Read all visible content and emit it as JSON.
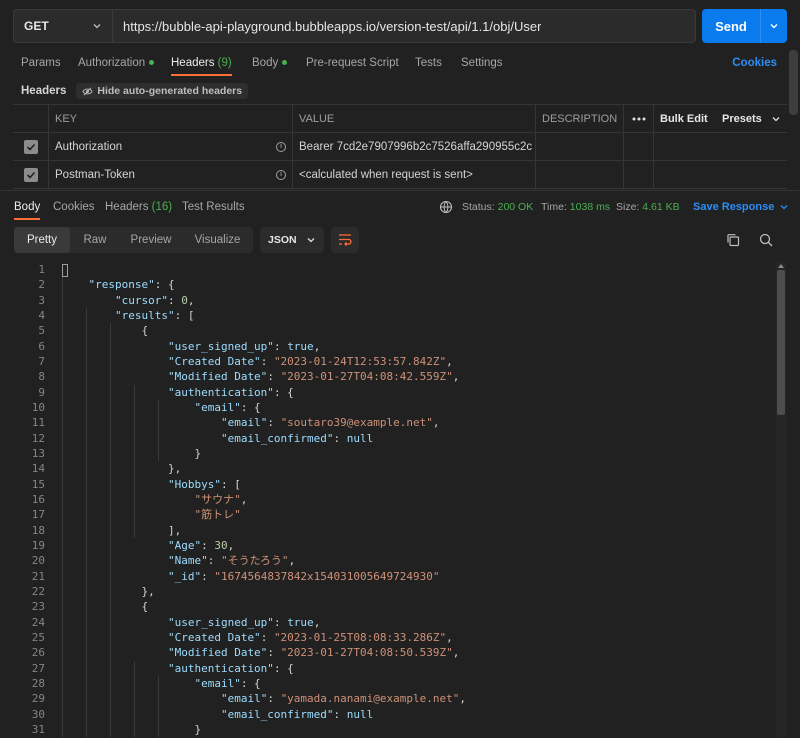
{
  "request": {
    "method": "GET",
    "url": "https://bubble-api-playground.bubbleapps.io/version-test/api/1.1/obj/User",
    "send_label": "Send"
  },
  "req_tabs": [
    {
      "label": "Params",
      "active": false
    },
    {
      "label": "Authorization",
      "dot": true,
      "active": false
    },
    {
      "label": "Headers",
      "count": "(9)",
      "active": true
    },
    {
      "label": "Body",
      "dot": true,
      "active": false
    },
    {
      "label": "Pre-request Script",
      "active": false
    },
    {
      "label": "Tests",
      "active": false
    },
    {
      "label": "Settings",
      "active": false
    }
  ],
  "cookies_label": "Cookies",
  "headers_section": {
    "title": "Headers",
    "hide_label": "Hide auto-generated headers"
  },
  "headers_table": {
    "columns": {
      "key": "KEY",
      "value": "VALUE",
      "description": "DESCRIPTION",
      "bulk_edit": "Bulk Edit",
      "presets": "Presets"
    },
    "rows": [
      {
        "key": "Authorization",
        "value": "Bearer 7cd2e7907996b2c7526affa290955c2c",
        "checked": true
      },
      {
        "key": "Postman-Token",
        "value": "<calculated when request is sent>",
        "checked": true
      }
    ]
  },
  "response": {
    "tabs": [
      {
        "label": "Body",
        "active": true
      },
      {
        "label": "Cookies",
        "active": false
      },
      {
        "label": "Headers",
        "count": "(16)",
        "active": false
      },
      {
        "label": "Test Results",
        "active": false
      }
    ],
    "status_label": "Status:",
    "status_value": "200 OK",
    "time_label": "Time:",
    "time_value": "1038 ms",
    "size_label": "Size:",
    "size_value": "4.61 KB",
    "save_label": "Save Response",
    "views": [
      "Pretty",
      "Raw",
      "Preview",
      "Visualize"
    ],
    "active_view": "Pretty",
    "format": "JSON"
  },
  "code_lines": [
    [
      [
        "p",
        "{"
      ]
    ],
    [
      [
        "p",
        "    "
      ],
      [
        "k",
        "\"response\""
      ],
      [
        "p",
        ": {"
      ]
    ],
    [
      [
        "p",
        "        "
      ],
      [
        "k",
        "\"cursor\""
      ],
      [
        "p",
        ": "
      ],
      [
        "n",
        "0"
      ],
      [
        "p",
        ","
      ]
    ],
    [
      [
        "p",
        "        "
      ],
      [
        "k",
        "\"results\""
      ],
      [
        "p",
        ": ["
      ]
    ],
    [
      [
        "p",
        "            {"
      ]
    ],
    [
      [
        "p",
        "                "
      ],
      [
        "k",
        "\"user_signed_up\""
      ],
      [
        "p",
        ": "
      ],
      [
        "b",
        "true"
      ],
      [
        "p",
        ","
      ]
    ],
    [
      [
        "p",
        "                "
      ],
      [
        "k",
        "\"Created Date\""
      ],
      [
        "p",
        ": "
      ],
      [
        "s",
        "\"2023-01-24T12:53:57.842Z\""
      ],
      [
        "p",
        ","
      ]
    ],
    [
      [
        "p",
        "                "
      ],
      [
        "k",
        "\"Modified Date\""
      ],
      [
        "p",
        ": "
      ],
      [
        "s",
        "\"2023-01-27T04:08:42.559Z\""
      ],
      [
        "p",
        ","
      ]
    ],
    [
      [
        "p",
        "                "
      ],
      [
        "k",
        "\"authentication\""
      ],
      [
        "p",
        ": {"
      ]
    ],
    [
      [
        "p",
        "                    "
      ],
      [
        "k",
        "\"email\""
      ],
      [
        "p",
        ": {"
      ]
    ],
    [
      [
        "p",
        "                        "
      ],
      [
        "k",
        "\"email\""
      ],
      [
        "p",
        ": "
      ],
      [
        "s",
        "\"soutaro39@example.net\""
      ],
      [
        "p",
        ","
      ]
    ],
    [
      [
        "p",
        "                        "
      ],
      [
        "k",
        "\"email_confirmed\""
      ],
      [
        "p",
        ": "
      ],
      [
        "nl",
        "null"
      ]
    ],
    [
      [
        "p",
        "                    }"
      ]
    ],
    [
      [
        "p",
        "                },"
      ]
    ],
    [
      [
        "p",
        "                "
      ],
      [
        "k",
        "\"Hobbys\""
      ],
      [
        "p",
        ": ["
      ]
    ],
    [
      [
        "p",
        "                    "
      ],
      [
        "s",
        "\"サウナ\""
      ],
      [
        "p",
        ","
      ]
    ],
    [
      [
        "p",
        "                    "
      ],
      [
        "s",
        "\"筋トレ\""
      ]
    ],
    [
      [
        "p",
        "                ],"
      ]
    ],
    [
      [
        "p",
        "                "
      ],
      [
        "k",
        "\"Age\""
      ],
      [
        "p",
        ": "
      ],
      [
        "n",
        "30"
      ],
      [
        "p",
        ","
      ]
    ],
    [
      [
        "p",
        "                "
      ],
      [
        "k",
        "\"Name\""
      ],
      [
        "p",
        ": "
      ],
      [
        "s",
        "\"そうたろう\""
      ],
      [
        "p",
        ","
      ]
    ],
    [
      [
        "p",
        "                "
      ],
      [
        "k",
        "\"_id\""
      ],
      [
        "p",
        ": "
      ],
      [
        "s",
        "\"1674564837842x154031005649724930\""
      ]
    ],
    [
      [
        "p",
        "            },"
      ]
    ],
    [
      [
        "p",
        "            {"
      ]
    ],
    [
      [
        "p",
        "                "
      ],
      [
        "k",
        "\"user_signed_up\""
      ],
      [
        "p",
        ": "
      ],
      [
        "b",
        "true"
      ],
      [
        "p",
        ","
      ]
    ],
    [
      [
        "p",
        "                "
      ],
      [
        "k",
        "\"Created Date\""
      ],
      [
        "p",
        ": "
      ],
      [
        "s",
        "\"2023-01-25T08:08:33.286Z\""
      ],
      [
        "p",
        ","
      ]
    ],
    [
      [
        "p",
        "                "
      ],
      [
        "k",
        "\"Modified Date\""
      ],
      [
        "p",
        ": "
      ],
      [
        "s",
        "\"2023-01-27T04:08:50.539Z\""
      ],
      [
        "p",
        ","
      ]
    ],
    [
      [
        "p",
        "                "
      ],
      [
        "k",
        "\"authentication\""
      ],
      [
        "p",
        ": {"
      ]
    ],
    [
      [
        "p",
        "                    "
      ],
      [
        "k",
        "\"email\""
      ],
      [
        "p",
        ": {"
      ]
    ],
    [
      [
        "p",
        "                        "
      ],
      [
        "k",
        "\"email\""
      ],
      [
        "p",
        ": "
      ],
      [
        "s",
        "\"yamada.nanami@example.net\""
      ],
      [
        "p",
        ","
      ]
    ],
    [
      [
        "p",
        "                        "
      ],
      [
        "k",
        "\"email_confirmed\""
      ],
      [
        "p",
        ": "
      ],
      [
        "nl",
        "null"
      ]
    ],
    [
      [
        "p",
        "                    }"
      ]
    ]
  ]
}
